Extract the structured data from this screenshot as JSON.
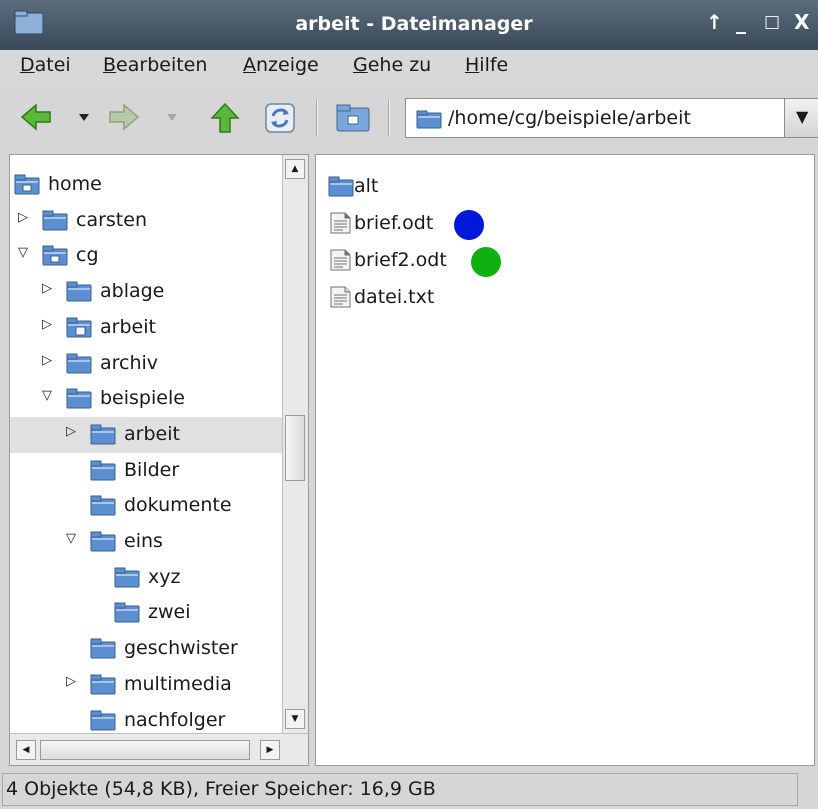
{
  "window": {
    "title": "arbeit - Dateimanager",
    "controls": [
      "↑",
      "_",
      "□",
      "X"
    ]
  },
  "menu": {
    "items": [
      {
        "underline": "D",
        "rest": "atei"
      },
      {
        "underline": "B",
        "rest": "earbeiten"
      },
      {
        "underline": "A",
        "rest": "nzeige"
      },
      {
        "underline": "G",
        "rest": "ehe zu"
      },
      {
        "underline": "H",
        "rest": "ilfe"
      }
    ]
  },
  "toolbar": {
    "path": "/home/cg/beispiele/arbeit",
    "dropdown_glyph": "▼"
  },
  "tree": {
    "items": [
      {
        "label": "home",
        "icon": "home-folder-icon",
        "expander": ""
      },
      {
        "label": "carsten",
        "icon": "folder-icon",
        "expander": "collapsed"
      },
      {
        "label": "cg",
        "icon": "home-folder-icon",
        "expander": "expanded"
      },
      {
        "label": "ablage",
        "icon": "folder-icon",
        "expander": "collapsed"
      },
      {
        "label": "arbeit",
        "icon": "doc-folder-icon",
        "expander": "collapsed"
      },
      {
        "label": "archiv",
        "icon": "folder-icon",
        "expander": "collapsed"
      },
      {
        "label": "beispiele",
        "icon": "folder-icon",
        "expander": "expanded"
      },
      {
        "label": "arbeit",
        "icon": "folder-icon",
        "expander": "collapsed",
        "selected": true
      },
      {
        "label": "Bilder",
        "icon": "folder-icon",
        "expander": ""
      },
      {
        "label": "dokumente",
        "icon": "folder-icon",
        "expander": ""
      },
      {
        "label": "eins",
        "icon": "folder-icon",
        "expander": "expanded"
      },
      {
        "label": "xyz",
        "icon": "folder-icon",
        "expander": ""
      },
      {
        "label": "zwei",
        "icon": "folder-icon",
        "expander": ""
      },
      {
        "label": "geschwister",
        "icon": "folder-icon",
        "expander": ""
      },
      {
        "label": "multimedia",
        "icon": "folder-icon",
        "expander": "collapsed"
      },
      {
        "label": "nachfolger",
        "icon": "folder-icon",
        "expander": ""
      }
    ]
  },
  "files": {
    "items": [
      {
        "label": "alt",
        "icon": "folder-icon"
      },
      {
        "label": "brief.odt",
        "icon": "odt-document-icon",
        "marker_color": "#0018d8"
      },
      {
        "label": "brief2.odt",
        "icon": "odt-document-icon",
        "marker_color": "#10b010"
      },
      {
        "label": "datei.txt",
        "icon": "text-file-icon"
      }
    ]
  },
  "status": {
    "text": "4 Objekte (54,8 KB), Freier Speicher: 16,9 GB"
  },
  "colors": {
    "folder": "#5c8fd0",
    "selection": "#e0e0e0",
    "nav_green": "#4caf34"
  }
}
